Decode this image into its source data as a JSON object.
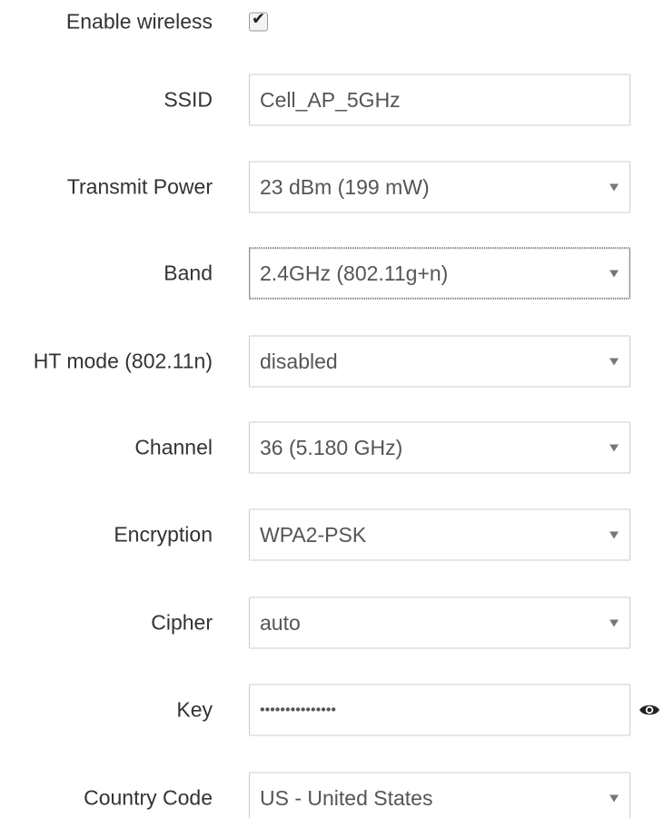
{
  "form": {
    "enable_wireless": {
      "label": "Enable wireless",
      "checked": true
    },
    "ssid": {
      "label": "SSID",
      "value": "Cell_AP_5GHz"
    },
    "transmit_power": {
      "label": "Transmit Power",
      "value": "23 dBm (199 mW)"
    },
    "band": {
      "label": "Band",
      "value": "2.4GHz (802.11g+n)"
    },
    "ht_mode": {
      "label": "HT mode (802.11n)",
      "value": "disabled"
    },
    "channel": {
      "label": "Channel",
      "value": "36 (5.180 GHz)"
    },
    "encryption": {
      "label": "Encryption",
      "value": "WPA2-PSK"
    },
    "cipher": {
      "label": "Cipher",
      "value": "auto"
    },
    "key": {
      "label": "Key",
      "masked_value": "•••••••••••••••",
      "reveal_icon": "eye-icon"
    },
    "country_code": {
      "label": "Country Code",
      "value": "US - United States"
    }
  },
  "icons": {
    "dropdown": "chevron-down-icon",
    "checkbox_mark": "checkmark-icon"
  },
  "colors": {
    "label_text": "#333333",
    "input_text": "#555555",
    "input_border": "#cccccc",
    "caret": "#777777"
  }
}
